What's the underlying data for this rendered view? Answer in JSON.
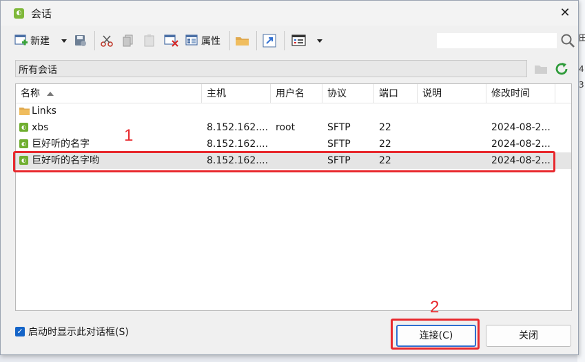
{
  "window": {
    "title": "会话",
    "close_glyph": "✕"
  },
  "toolbar": {
    "new_label": "新建",
    "properties_label": "属性",
    "search": {
      "value": "",
      "placeholder": ""
    }
  },
  "path": {
    "label": "所有会话"
  },
  "columns": [
    "名称",
    "主机",
    "用户名",
    "协议",
    "端口",
    "说明",
    "修改时间"
  ],
  "rows": [
    {
      "type": "folder",
      "name": "Links",
      "host": "",
      "user": "",
      "protocol": "",
      "port": "",
      "desc": "",
      "modified": ""
    },
    {
      "type": "session",
      "name": "xbs",
      "host": "8.152.162....",
      "user": "root",
      "protocol": "SFTP",
      "port": "22",
      "desc": "",
      "modified": "2024-08-2..."
    },
    {
      "type": "session",
      "name": "巨好听的名字",
      "host": "8.152.162....",
      "user": "",
      "protocol": "SFTP",
      "port": "22",
      "desc": "",
      "modified": "2024-08-2..."
    },
    {
      "type": "session",
      "name": "巨好听的名字哟",
      "host": "8.152.162....",
      "user": "",
      "protocol": "SFTP",
      "port": "22",
      "desc": "",
      "modified": "2024-08-2..."
    }
  ],
  "footer": {
    "startup_checkbox_label": "启动时显示此对话框(S)",
    "startup_checked": true,
    "connect_label": "连接(C)",
    "close_label": "关闭"
  },
  "annotations": {
    "label1": "1",
    "label2": "2"
  },
  "background": {
    "right_chars": [
      "田",
      "4",
      "3"
    ]
  },
  "colors": {
    "annotation": "#e8282d",
    "session_icon": "#6fae2f",
    "accent": "#1464c8"
  }
}
